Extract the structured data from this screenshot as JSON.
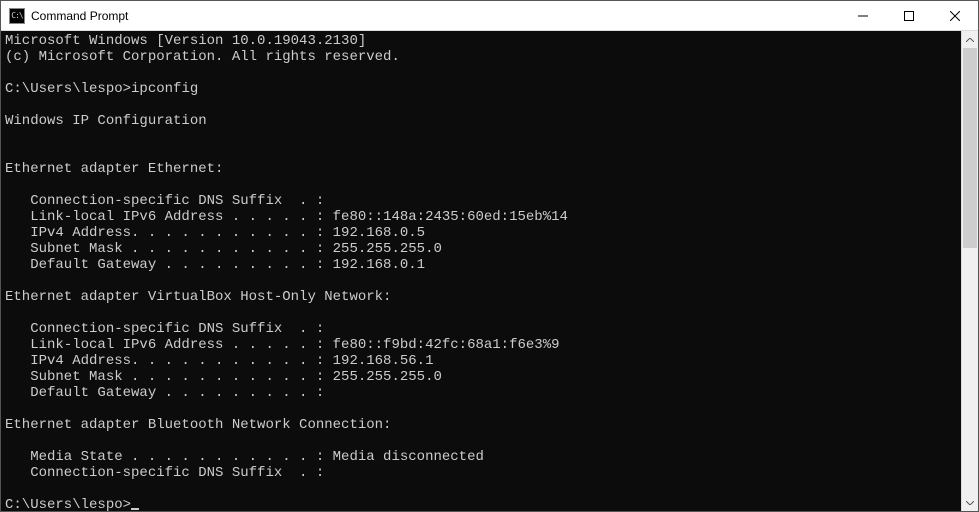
{
  "titlebar": {
    "icon_text": "C:\\",
    "title": "Command Prompt"
  },
  "console": {
    "header_line1": "Microsoft Windows [Version 10.0.19043.2130]",
    "header_line2": "(c) Microsoft Corporation. All rights reserved.",
    "prompt1_path": "C:\\Users\\lespo>",
    "prompt1_cmd": "ipconfig",
    "ipconfig_title": "Windows IP Configuration",
    "adapters": [
      {
        "header": "Ethernet adapter Ethernet:",
        "lines": [
          "   Connection-specific DNS Suffix  . :",
          "   Link-local IPv6 Address . . . . . : fe80::148a:2435:60ed:15eb%14",
          "   IPv4 Address. . . . . . . . . . . : 192.168.0.5",
          "   Subnet Mask . . . . . . . . . . . : 255.255.255.0",
          "   Default Gateway . . . . . . . . . : 192.168.0.1"
        ]
      },
      {
        "header": "Ethernet adapter VirtualBox Host-Only Network:",
        "lines": [
          "   Connection-specific DNS Suffix  . :",
          "   Link-local IPv6 Address . . . . . : fe80::f9bd:42fc:68a1:f6e3%9",
          "   IPv4 Address. . . . . . . . . . . : 192.168.56.1",
          "   Subnet Mask . . . . . . . . . . . : 255.255.255.0",
          "   Default Gateway . . . . . . . . . :"
        ]
      },
      {
        "header": "Ethernet adapter Bluetooth Network Connection:",
        "lines": [
          "   Media State . . . . . . . . . . . : Media disconnected",
          "   Connection-specific DNS Suffix  . :"
        ]
      }
    ],
    "prompt2_path": "C:\\Users\\lespo>"
  }
}
